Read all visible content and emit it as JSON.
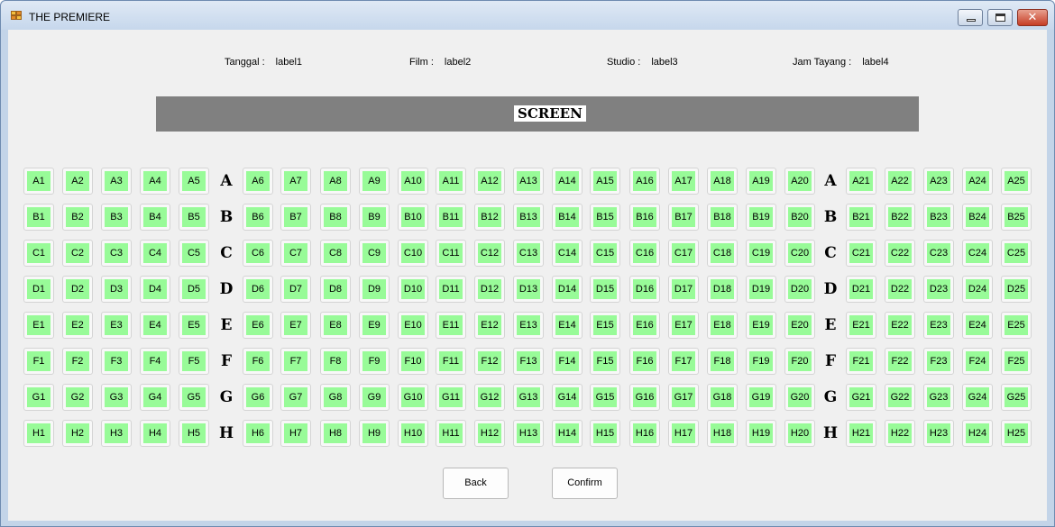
{
  "window": {
    "title": "THE PREMIERE",
    "minimize_glyph": "",
    "maximize_glyph": "",
    "close_glyph": "✕"
  },
  "info": {
    "tanggal_label": "Tanggal :",
    "tanggal_value": "label1",
    "film_label": "Film :",
    "film_value": "label2",
    "studio_label": "Studio :",
    "studio_value": "label3",
    "jam_label": "Jam Tayang :",
    "jam_value": "label4"
  },
  "screen_label": "SCREEN",
  "rows": [
    "A",
    "B",
    "C",
    "D",
    "E",
    "F",
    "G",
    "H"
  ],
  "seats_per_row": 25,
  "seat_color": "#98fb98",
  "buttons": {
    "back": "Back",
    "confirm": "Confirm"
  }
}
